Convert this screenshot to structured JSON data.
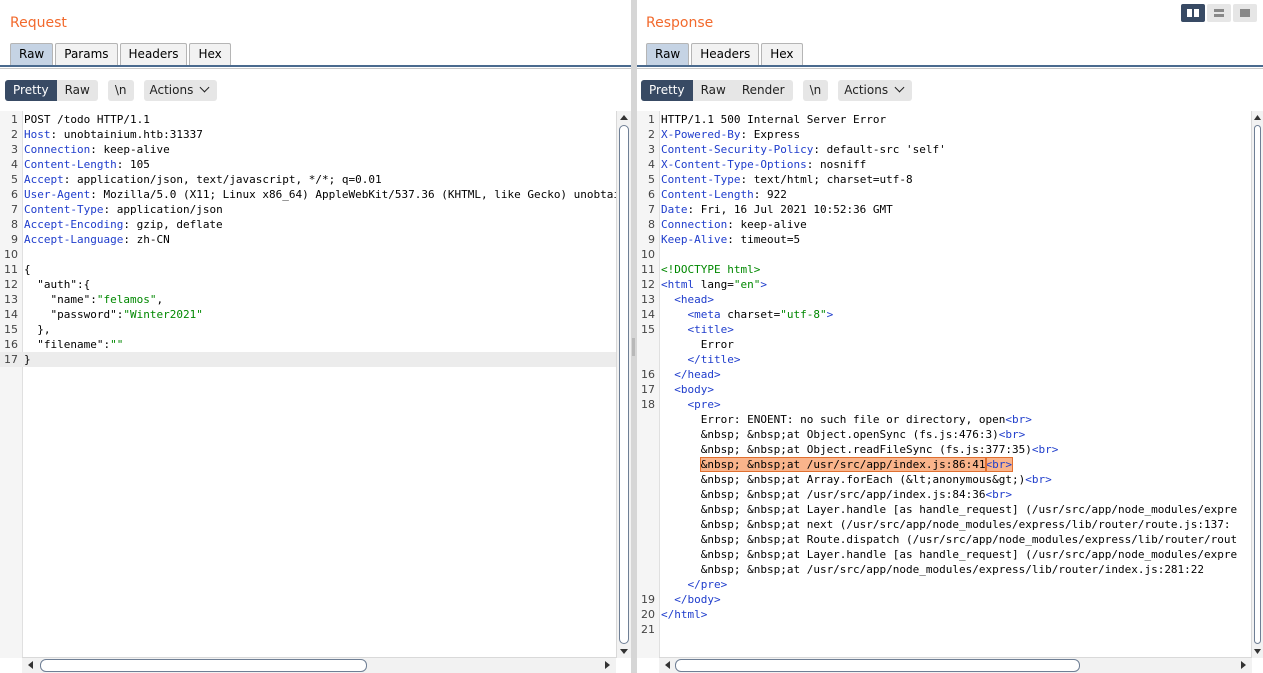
{
  "request": {
    "title": "Request",
    "tabs": [
      {
        "label": "Raw",
        "active": true
      },
      {
        "label": "Params",
        "active": false
      },
      {
        "label": "Headers",
        "active": false
      },
      {
        "label": "Hex",
        "active": false
      }
    ],
    "view_modes": [
      {
        "label": "Pretty",
        "active": true
      },
      {
        "label": "Raw",
        "active": false
      }
    ],
    "newline_label": "\\n",
    "actions_label": "Actions",
    "lines": [
      [
        {
          "t": "POST /todo HTTP/1.1"
        }
      ],
      [
        {
          "t": "Host",
          "c": "hk"
        },
        {
          "t": ": unobtainium.htb:31337"
        }
      ],
      [
        {
          "t": "Connection",
          "c": "hk"
        },
        {
          "t": ": keep-alive"
        }
      ],
      [
        {
          "t": "Content-Length",
          "c": "hk"
        },
        {
          "t": ": 105"
        }
      ],
      [
        {
          "t": "Accept",
          "c": "hk"
        },
        {
          "t": ": application/json, text/javascript, */*; q=0.01"
        }
      ],
      [
        {
          "t": "User-Agent",
          "c": "hk"
        },
        {
          "t": ": Mozilla/5.0 (X11; Linux x86_64) AppleWebKit/537.36 (KHTML, like Gecko) unobtai"
        }
      ],
      [
        {
          "t": "Content-Type",
          "c": "hk"
        },
        {
          "t": ": application/json"
        }
      ],
      [
        {
          "t": "Accept-Encoding",
          "c": "hk"
        },
        {
          "t": ": gzip, deflate"
        }
      ],
      [
        {
          "t": "Accept-Language",
          "c": "hk"
        },
        {
          "t": ": zh-CN"
        }
      ],
      [
        {
          "t": ""
        }
      ],
      [
        {
          "t": "{"
        }
      ],
      [
        {
          "t": "  \"auth\":{"
        }
      ],
      [
        {
          "t": "    \"name\":"
        },
        {
          "t": "\"felamos\"",
          "c": "sv"
        },
        {
          "t": ","
        }
      ],
      [
        {
          "t": "    \"password\":"
        },
        {
          "t": "\"Winter2021\"",
          "c": "sv"
        }
      ],
      [
        {
          "t": "  },"
        }
      ],
      [
        {
          "t": "  \"filename\":"
        },
        {
          "t": "\"\"",
          "c": "sv"
        }
      ],
      [
        {
          "t": "}"
        }
      ]
    ]
  },
  "response": {
    "title": "Response",
    "tabs": [
      {
        "label": "Raw",
        "active": true
      },
      {
        "label": "Headers",
        "active": false
      },
      {
        "label": "Hex",
        "active": false
      }
    ],
    "view_modes": [
      {
        "label": "Pretty",
        "active": true
      },
      {
        "label": "Raw",
        "active": false
      },
      {
        "label": "Render",
        "active": false
      }
    ],
    "newline_label": "\\n",
    "actions_label": "Actions",
    "lines": [
      {
        "n": "1",
        "s": [
          {
            "t": "HTTP/1.1 500 Internal Server Error"
          }
        ]
      },
      {
        "n": "2",
        "s": [
          {
            "t": "X-Powered-By",
            "c": "hk"
          },
          {
            "t": ": Express"
          }
        ]
      },
      {
        "n": "3",
        "s": [
          {
            "t": "Content-Security-Policy",
            "c": "hk"
          },
          {
            "t": ": default-src 'self'"
          }
        ]
      },
      {
        "n": "4",
        "s": [
          {
            "t": "X-Content-Type-Options",
            "c": "hk"
          },
          {
            "t": ": nosniff"
          }
        ]
      },
      {
        "n": "5",
        "s": [
          {
            "t": "Content-Type",
            "c": "hk"
          },
          {
            "t": ": text/html; charset=utf-8"
          }
        ]
      },
      {
        "n": "6",
        "s": [
          {
            "t": "Content-Length",
            "c": "hk"
          },
          {
            "t": ": 922"
          }
        ]
      },
      {
        "n": "7",
        "s": [
          {
            "t": "Date",
            "c": "hk"
          },
          {
            "t": ": Fri, 16 Jul 2021 10:52:36 GMT"
          }
        ]
      },
      {
        "n": "8",
        "s": [
          {
            "t": "Connection",
            "c": "hk"
          },
          {
            "t": ": keep-alive"
          }
        ]
      },
      {
        "n": "9",
        "s": [
          {
            "t": "Keep-Alive",
            "c": "hk"
          },
          {
            "t": ": timeout=5"
          }
        ]
      },
      {
        "n": "10",
        "s": [
          {
            "t": ""
          }
        ]
      },
      {
        "n": "11",
        "s": [
          {
            "t": "<!DOCTYPE html>",
            "c": "dt"
          }
        ]
      },
      {
        "n": "12",
        "s": [
          {
            "t": "<html",
            "c": "tg"
          },
          {
            "t": " lang="
          },
          {
            "t": "\"en\"",
            "c": "sv"
          },
          {
            "t": ">",
            "c": "tg"
          }
        ]
      },
      {
        "n": "13",
        "s": [
          {
            "t": "  "
          },
          {
            "t": "<head>",
            "c": "tg"
          }
        ]
      },
      {
        "n": "14",
        "s": [
          {
            "t": "    "
          },
          {
            "t": "<meta",
            "c": "tg"
          },
          {
            "t": " charset="
          },
          {
            "t": "\"utf-8\"",
            "c": "sv"
          },
          {
            "t": ">",
            "c": "tg"
          }
        ]
      },
      {
        "n": "15",
        "s": [
          {
            "t": "    "
          },
          {
            "t": "<title>",
            "c": "tg"
          }
        ]
      },
      {
        "n": "",
        "s": [
          {
            "t": "      Error"
          }
        ]
      },
      {
        "n": "",
        "s": [
          {
            "t": "    "
          },
          {
            "t": "</title>",
            "c": "tg"
          }
        ]
      },
      {
        "n": "16",
        "s": [
          {
            "t": "  "
          },
          {
            "t": "</head>",
            "c": "tg"
          }
        ]
      },
      {
        "n": "17",
        "s": [
          {
            "t": "  "
          },
          {
            "t": "<body>",
            "c": "tg"
          }
        ]
      },
      {
        "n": "18",
        "s": [
          {
            "t": "    "
          },
          {
            "t": "<pre>",
            "c": "tg"
          }
        ]
      },
      {
        "n": "",
        "s": [
          {
            "t": "      Error: ENOENT: no such file or directory, open"
          },
          {
            "t": "<br>",
            "c": "tg"
          }
        ]
      },
      {
        "n": "",
        "s": [
          {
            "t": "      &nbsp; &nbsp;at Object.openSync (fs.js:476:3)"
          },
          {
            "t": "<br>",
            "c": "tg"
          }
        ]
      },
      {
        "n": "",
        "s": [
          {
            "t": "      &nbsp; &nbsp;at Object.readFileSync (fs.js:377:35)"
          },
          {
            "t": "<br>",
            "c": "tg"
          }
        ]
      },
      {
        "n": "",
        "s": [
          {
            "t": "      "
          },
          {
            "t": "&nbsp; &nbsp;at /usr/src/app/index.js:86:41",
            "c": "hl"
          },
          {
            "t": "<br>",
            "c": "tg hl"
          }
        ]
      },
      {
        "n": "",
        "s": [
          {
            "t": "      &nbsp; &nbsp;at Array.forEach (&lt;anonymous&gt;)"
          },
          {
            "t": "<br>",
            "c": "tg"
          }
        ]
      },
      {
        "n": "",
        "s": [
          {
            "t": "      &nbsp; &nbsp;at /usr/src/app/index.js:84:36"
          },
          {
            "t": "<br>",
            "c": "tg"
          }
        ]
      },
      {
        "n": "",
        "s": [
          {
            "t": "      &nbsp; &nbsp;at Layer.handle [as handle_request] (/usr/src/app/node_modules/expre"
          }
        ]
      },
      {
        "n": "",
        "s": [
          {
            "t": "      &nbsp; &nbsp;at next (/usr/src/app/node_modules/express/lib/router/route.js:137:"
          }
        ]
      },
      {
        "n": "",
        "s": [
          {
            "t": "      &nbsp; &nbsp;at Route.dispatch (/usr/src/app/node_modules/express/lib/router/rout"
          }
        ]
      },
      {
        "n": "",
        "s": [
          {
            "t": "      &nbsp; &nbsp;at Layer.handle [as handle_request] (/usr/src/app/node_modules/expre"
          }
        ]
      },
      {
        "n": "",
        "s": [
          {
            "t": "      &nbsp; &nbsp;at /usr/src/app/node_modules/express/lib/router/index.js:281:22"
          }
        ]
      },
      {
        "n": "",
        "s": [
          {
            "t": "    "
          },
          {
            "t": "</pre>",
            "c": "tg"
          }
        ]
      },
      {
        "n": "19",
        "s": [
          {
            "t": "  "
          },
          {
            "t": "</body>",
            "c": "tg"
          }
        ]
      },
      {
        "n": "20",
        "s": [
          {
            "t": "</html>",
            "c": "tg"
          }
        ]
      },
      {
        "n": "21",
        "s": [
          {
            "t": ""
          }
        ]
      }
    ]
  },
  "layout_buttons": [
    {
      "icon": "split-horizontal-icon",
      "active": true
    },
    {
      "icon": "split-vertical-icon",
      "active": false
    },
    {
      "icon": "single-pane-icon",
      "active": false
    }
  ],
  "colors": {
    "title": "#f26a2d",
    "header_key": "#1f3dcc",
    "string": "#008800",
    "active_button": "#384a64",
    "highlight": "#f9b48b"
  }
}
